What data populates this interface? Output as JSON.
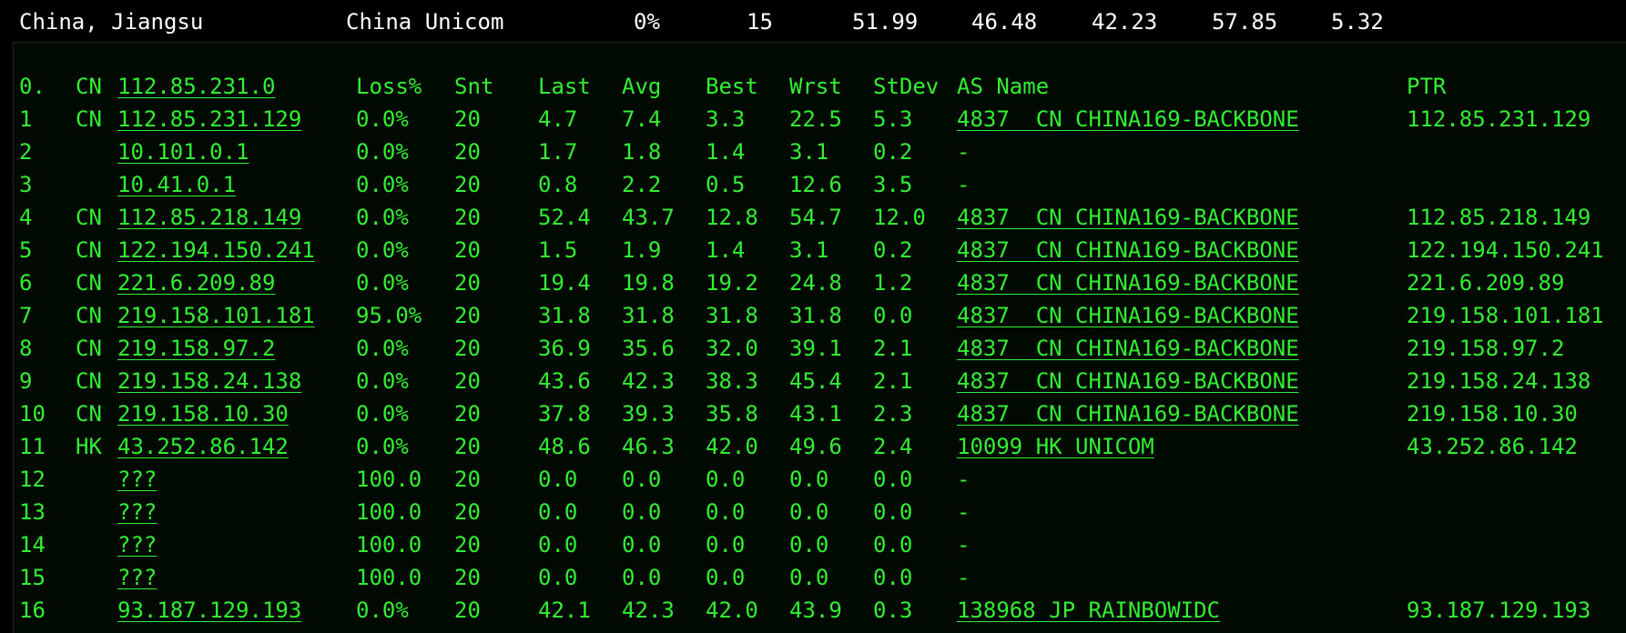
{
  "summary": {
    "location": "China, Jiangsu",
    "isp": "China Unicom",
    "loss": "0%",
    "sent": "15",
    "v1": "51.99",
    "v2": "46.48",
    "v3": "42.23",
    "v4": "57.85",
    "v5": "5.32"
  },
  "colors": {
    "text": "#33ee33",
    "background": "#000a00",
    "header_text": "#ffffff"
  },
  "table": {
    "header": {
      "hop": "0.",
      "cc": "CN",
      "ip": "112.85.231.0",
      "loss": "Loss%",
      "snt": "Snt",
      "last": "Last",
      "avg": "Avg",
      "best": "Best",
      "wrst": "Wrst",
      "stdev": "StDev",
      "as": "AS Name",
      "ptr": "PTR"
    },
    "rows": [
      {
        "hop": "1",
        "cc": "CN",
        "ip": "112.85.231.129",
        "loss": "0.0%",
        "snt": "20",
        "last": "4.7",
        "avg": "7.4",
        "best": "3.3",
        "wrst": "22.5",
        "stdev": "5.3",
        "as": "4837  CN CHINA169-BACKBONE",
        "ptr": "112.85.231.129"
      },
      {
        "hop": "2",
        "cc": "",
        "ip": "10.101.0.1",
        "loss": "0.0%",
        "snt": "20",
        "last": "1.7",
        "avg": "1.8",
        "best": "1.4",
        "wrst": "3.1",
        "stdev": "0.2",
        "as": "-",
        "ptr": ""
      },
      {
        "hop": "3",
        "cc": "",
        "ip": "10.41.0.1",
        "loss": "0.0%",
        "snt": "20",
        "last": "0.8",
        "avg": "2.2",
        "best": "0.5",
        "wrst": "12.6",
        "stdev": "3.5",
        "as": "-",
        "ptr": ""
      },
      {
        "hop": "4",
        "cc": "CN",
        "ip": "112.85.218.149",
        "loss": "0.0%",
        "snt": "20",
        "last": "52.4",
        "avg": "43.7",
        "best": "12.8",
        "wrst": "54.7",
        "stdev": "12.0",
        "as": "4837  CN CHINA169-BACKBONE",
        "ptr": "112.85.218.149"
      },
      {
        "hop": "5",
        "cc": "CN",
        "ip": "122.194.150.241",
        "loss": "0.0%",
        "snt": "20",
        "last": "1.5",
        "avg": "1.9",
        "best": "1.4",
        "wrst": "3.1",
        "stdev": "0.2",
        "as": "4837  CN CHINA169-BACKBONE",
        "ptr": "122.194.150.241"
      },
      {
        "hop": "6",
        "cc": "CN",
        "ip": "221.6.209.89",
        "loss": "0.0%",
        "snt": "20",
        "last": "19.4",
        "avg": "19.8",
        "best": "19.2",
        "wrst": "24.8",
        "stdev": "1.2",
        "as": "4837  CN CHINA169-BACKBONE",
        "ptr": "221.6.209.89"
      },
      {
        "hop": "7",
        "cc": "CN",
        "ip": "219.158.101.181",
        "loss": "95.0%",
        "snt": "20",
        "last": "31.8",
        "avg": "31.8",
        "best": "31.8",
        "wrst": "31.8",
        "stdev": "0.0",
        "as": "4837  CN CHINA169-BACKBONE",
        "ptr": "219.158.101.181"
      },
      {
        "hop": "8",
        "cc": "CN",
        "ip": "219.158.97.2",
        "loss": "0.0%",
        "snt": "20",
        "last": "36.9",
        "avg": "35.6",
        "best": "32.0",
        "wrst": "39.1",
        "stdev": "2.1",
        "as": "4837  CN CHINA169-BACKBONE",
        "ptr": "219.158.97.2"
      },
      {
        "hop": "9",
        "cc": "CN",
        "ip": "219.158.24.138",
        "loss": "0.0%",
        "snt": "20",
        "last": "43.6",
        "avg": "42.3",
        "best": "38.3",
        "wrst": "45.4",
        "stdev": "2.1",
        "as": "4837  CN CHINA169-BACKBONE",
        "ptr": "219.158.24.138"
      },
      {
        "hop": "10",
        "cc": "CN",
        "ip": "219.158.10.30",
        "loss": "0.0%",
        "snt": "20",
        "last": "37.8",
        "avg": "39.3",
        "best": "35.8",
        "wrst": "43.1",
        "stdev": "2.3",
        "as": "4837  CN CHINA169-BACKBONE",
        "ptr": "219.158.10.30"
      },
      {
        "hop": "11",
        "cc": "HK",
        "ip": "43.252.86.142",
        "loss": "0.0%",
        "snt": "20",
        "last": "48.6",
        "avg": "46.3",
        "best": "42.0",
        "wrst": "49.6",
        "stdev": "2.4",
        "as": "10099 HK UNICOM",
        "ptr": "43.252.86.142"
      },
      {
        "hop": "12",
        "cc": "",
        "ip": "???",
        "loss": "100.0",
        "snt": "20",
        "last": "0.0",
        "avg": "0.0",
        "best": "0.0",
        "wrst": "0.0",
        "stdev": "0.0",
        "as": "-",
        "ptr": ""
      },
      {
        "hop": "13",
        "cc": "",
        "ip": "???",
        "loss": "100.0",
        "snt": "20",
        "last": "0.0",
        "avg": "0.0",
        "best": "0.0",
        "wrst": "0.0",
        "stdev": "0.0",
        "as": "-",
        "ptr": ""
      },
      {
        "hop": "14",
        "cc": "",
        "ip": "???",
        "loss": "100.0",
        "snt": "20",
        "last": "0.0",
        "avg": "0.0",
        "best": "0.0",
        "wrst": "0.0",
        "stdev": "0.0",
        "as": "-",
        "ptr": ""
      },
      {
        "hop": "15",
        "cc": "",
        "ip": "???",
        "loss": "100.0",
        "snt": "20",
        "last": "0.0",
        "avg": "0.0",
        "best": "0.0",
        "wrst": "0.0",
        "stdev": "0.0",
        "as": "-",
        "ptr": ""
      },
      {
        "hop": "16",
        "cc": "",
        "ip": "93.187.129.193",
        "loss": "0.0%",
        "snt": "20",
        "last": "42.1",
        "avg": "42.3",
        "best": "42.0",
        "wrst": "43.9",
        "stdev": "0.3",
        "as": "138968 JP RAINBOWIDC",
        "ptr": "93.187.129.193"
      }
    ]
  }
}
